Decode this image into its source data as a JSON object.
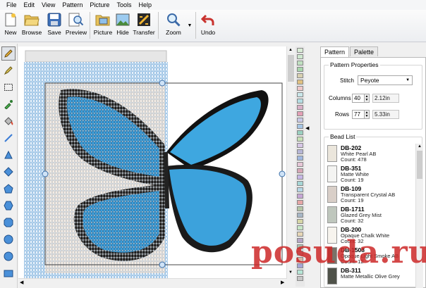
{
  "menu": [
    "File",
    "Edit",
    "View",
    "Pattern",
    "Picture",
    "Tools",
    "Help"
  ],
  "toolbar": {
    "new": "New",
    "browse": "Browse",
    "save": "Save",
    "preview": "Preview",
    "picture": "Picture",
    "hide": "Hide",
    "transfer": "Transfer",
    "zoom": "Zoom",
    "undo": "Undo"
  },
  "tabs": [
    "Pattern",
    "Palette"
  ],
  "pattern_properties": {
    "title": "Pattern Properties",
    "stitch_label": "Stitch",
    "stitch_value": "Peyote",
    "columns_label": "Columns",
    "columns_value": "40",
    "columns_inches": "2.12in",
    "rows_label": "Rows",
    "rows_value": "77",
    "rows_inches": "5.33in"
  },
  "bead_list": {
    "title": "Bead List",
    "items": [
      {
        "code": "DB-202",
        "name": "White Pearl AB",
        "count": "Count: 478",
        "color": "#ebe6dc"
      },
      {
        "code": "DB-351",
        "name": "Matte White",
        "count": "Count: 19",
        "color": "#f4f4f2"
      },
      {
        "code": "DB-109",
        "name": "Transparent Crystal AB",
        "count": "Count: 19",
        "color": "#d9cfc8"
      },
      {
        "code": "DB-1711",
        "name": "Glazed Grey Mist",
        "count": "Count: 32",
        "color": "#bfc7bd"
      },
      {
        "code": "DB-200",
        "name": "Opaque Chalk White",
        "count": "Count: 32",
        "color": "#f7f4ee"
      },
      {
        "code": "DB-1508",
        "name": "Opaque Light Smoke AB",
        "count": "Count: 12",
        "color": "#7a7268"
      },
      {
        "code": "DB-311",
        "name": "Matte Metallic Olive Grey",
        "count": "",
        "color": "#4f5249"
      }
    ]
  },
  "watermark": "posuda.ru",
  "colors": {
    "accent_blue": "#3aa0d8",
    "dark_wing": "#1b1b1b",
    "bead_grid": "#6fa8d9"
  }
}
